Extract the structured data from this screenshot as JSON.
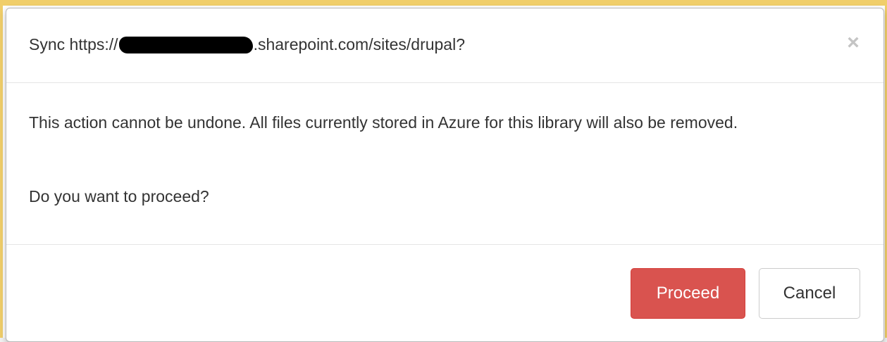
{
  "dialog": {
    "title_prefix": "Sync https://",
    "title_suffix": ".sharepoint.com/sites/drupal?",
    "close_glyph": "×",
    "close_icon": "close-icon"
  },
  "body": {
    "warning": "This action cannot be undone. All files currently stored in Azure for this library will also be removed.",
    "question": "Do you want to proceed?"
  },
  "footer": {
    "proceed_label": "Proceed",
    "cancel_label": "Cancel"
  },
  "colors": {
    "danger": "#d9534f",
    "frame_accent": "#f0ce6a"
  }
}
